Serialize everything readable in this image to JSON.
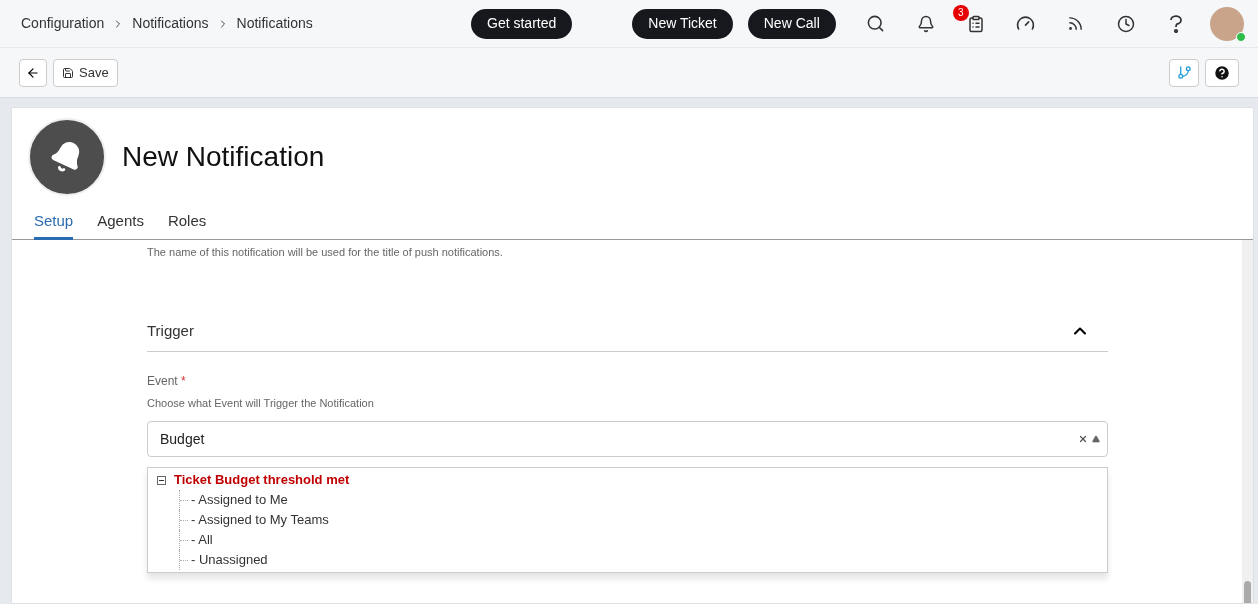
{
  "breadcrumb": [
    "Configuration",
    "Notifications",
    "Notifications"
  ],
  "header_buttons": [
    "Get started",
    "New Ticket",
    "New Call"
  ],
  "notification_badge": "3",
  "toolbar": {
    "save_label": "Save"
  },
  "page_title": "New Notification",
  "tabs": [
    {
      "label": "Setup",
      "selected": true
    },
    {
      "label": "Agents",
      "selected": false
    },
    {
      "label": "Roles",
      "selected": false
    }
  ],
  "name_hint": "The name of this notification will be used for the title of push notifications.",
  "section": {
    "title": "Trigger",
    "expanded": true
  },
  "event": {
    "label": "Event",
    "required_mark": "*",
    "hint": "Choose what Event will Trigger the Notification",
    "value": "Budget"
  },
  "dropdown": {
    "group": {
      "label": "Ticket Budget threshold met",
      "expanded": true,
      "children": [
        {
          "label": "- Assigned to Me"
        },
        {
          "label": "- Assigned to My Teams"
        },
        {
          "label": "- All"
        },
        {
          "label": "- Unassigned"
        }
      ]
    }
  }
}
